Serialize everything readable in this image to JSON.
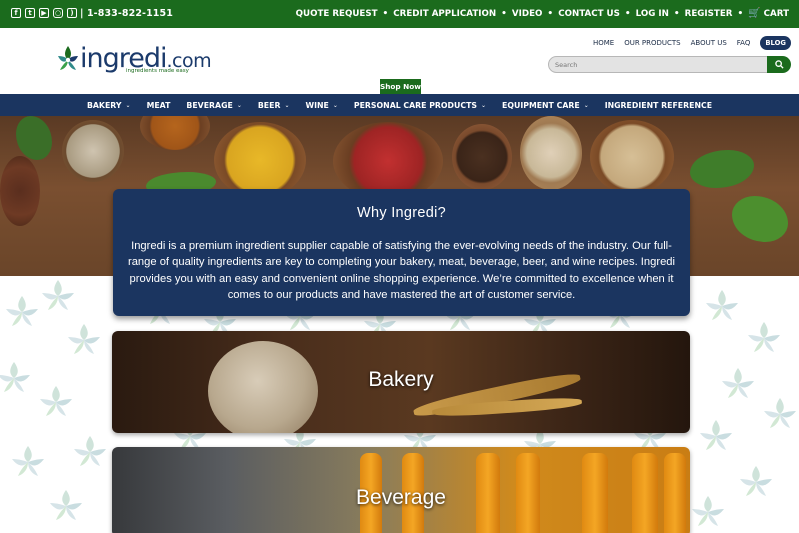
{
  "topbar": {
    "social_icons": [
      "facebook-icon",
      "twitter-icon",
      "youtube-icon",
      "instagram-icon",
      "rss-icon"
    ],
    "phone": "| 1-833-822-1151",
    "links": [
      "QUOTE REQUEST",
      "CREDIT APPLICATION",
      "VIDEO",
      "CONTACT US",
      "LOG IN",
      "REGISTER"
    ],
    "cart_label": "CART"
  },
  "logo": {
    "main": "ingredi",
    "suffix": ".com",
    "tagline": "ingredients made easy"
  },
  "utility_nav": {
    "items": [
      "HOME",
      "OUR PRODUCTS",
      "ABOUT US",
      "FAQ"
    ],
    "blog": "BLOG"
  },
  "search": {
    "placeholder": "Search"
  },
  "shop_now": "Shop Now",
  "main_nav": [
    {
      "label": "BAKERY",
      "dropdown": true
    },
    {
      "label": "MEAT",
      "dropdown": false
    },
    {
      "label": "BEVERAGE",
      "dropdown": true
    },
    {
      "label": "BEER",
      "dropdown": true
    },
    {
      "label": "WINE",
      "dropdown": true
    },
    {
      "label": "PERSONAL CARE PRODUCTS",
      "dropdown": true
    },
    {
      "label": "EQUIPMENT CARE",
      "dropdown": true
    },
    {
      "label": "INGREDIENT REFERENCE",
      "dropdown": false
    }
  ],
  "why": {
    "title": "Why Ingredi?",
    "body": "Ingredi is a premium ingredient supplier capable of satisfying the ever-evolving needs of the industry. Our full-range of quality ingredients are key to completing your bakery, meat, beverage, beer, and wine recipes. Ingredi provides you with an easy and convenient online shopping experience. We’re committed to excellence when it comes to our products and have mastered the art of customer service."
  },
  "tiles": [
    {
      "label": "Bakery"
    },
    {
      "label": "Beverage"
    }
  ],
  "colors": {
    "green": "#1b6b1d",
    "navy": "#1b3560"
  }
}
